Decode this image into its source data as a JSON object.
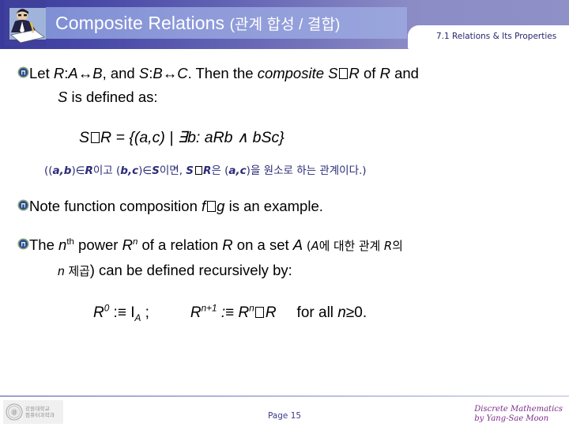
{
  "header": {
    "title_en": "Composite Relations",
    "title_ko": "(관계 합성 / 결합)",
    "chapter_label": "7.1 Relations & Its Properties",
    "logo_icon": "person-writing-icon",
    "band_color": "#8e9ad9",
    "bar_gradient_start": "#3a3a9c",
    "bar_gradient_end": "#9090c8",
    "title_color": "#ffffff",
    "chapter_color": "#262673"
  },
  "body": {
    "bullet_icon": "decorative-emblem-bullet-icon",
    "bullets": [
      {
        "id": "bullet-composite-definition",
        "line1_a": "Let ",
        "line1_r": "R",
        "line1_b": ":",
        "line1_ab": "A",
        "line1_arrow1": "↔",
        "line1_bb": "B",
        "line1_c": ", and ",
        "line1_s": "S",
        "line1_d": ":",
        "line1_bc": "B",
        "line1_arrow2": "↔",
        "line1_cc": "C",
        "line1_e": ".  Then the ",
        "line1_composite": "composite",
        "line1_f": " ",
        "line1_s2": "S",
        "line1_box": "□",
        "line1_r2": "R",
        "line1_g": " of ",
        "line1_r3": "R",
        "line1_h": " and",
        "line2_s": "S",
        "line2_rest": " is defined as:"
      }
    ],
    "formula1": {
      "s": "S",
      "box": "□",
      "r": "R",
      "rest": " = {(a,c) | ∃b: aRb ∧ bSc}"
    },
    "korean_note": {
      "p1": "((",
      "ab": "a,b",
      "p2": ")∈",
      "r1": "R",
      "p3": "이고 (",
      "bc": "b,c",
      "p4": ")∈",
      "s1": "S",
      "p5": "이면, ",
      "s2": "S",
      "box": "□",
      "r2": "R",
      "p6": "은 (",
      "ac": "a,c",
      "p7": ")을 원소로 하는 관계이다.)"
    },
    "bullet2": {
      "a": "Note function composition ",
      "f": "f",
      "box": "□",
      "g": "g",
      "b": " is an example."
    },
    "bullet3": {
      "a": "The ",
      "n1": "n",
      "th": "th",
      "b": " power ",
      "r1": "R",
      "sup_n": "n",
      "c": " of a relation ",
      "r2": "R",
      "d": " on a set ",
      "a_set": "A",
      "ko1_open": " (",
      "ko1_a": "A",
      "ko1_b": "에 대한 관계 ",
      "ko1_r": "R",
      "ko1_c": "의",
      "line2_n": "n",
      "line2_ko": " 제곱",
      "line2_close": ")",
      "line2_rest": " can be defined recursively by:"
    },
    "formula2": {
      "r0": "R",
      "sup0": "0",
      "def1": " :≡ I",
      "subA": "A",
      "semi": " ;",
      "r1": "R",
      "sup1": "n+1",
      "def2": " :≡ R",
      "sup2": "n",
      "box": "□",
      "r2": "R",
      "forall": "for all ",
      "nfinal": "n",
      "ge": "≥0."
    }
  },
  "footer": {
    "logo_icon": "university-seal-icon",
    "logo_text_line1": "강원대학교",
    "logo_text_line2": "컴퓨터과학과",
    "page_label": "Page 15",
    "credit_line1": "Discrete Mathematics",
    "credit_line2": "by Yang-Sae Moon",
    "credit_color": "#7c2b8a",
    "page_color": "#3b3b8c"
  }
}
